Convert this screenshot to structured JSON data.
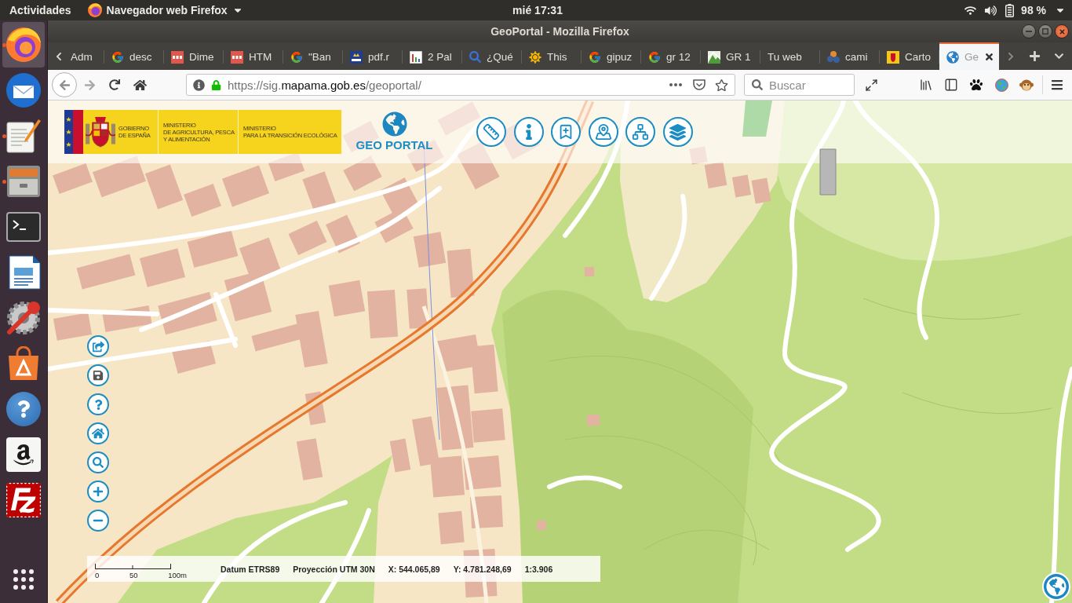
{
  "top_panel": {
    "activities": "Actividades",
    "app_menu": "Navegador web Firefox",
    "clock": "mié 17:31",
    "battery": "98 %"
  },
  "dock": {
    "items": [
      {
        "kind": "browser",
        "running": true,
        "selected": true
      },
      {
        "kind": "mail",
        "running": false,
        "selected": false
      },
      {
        "kind": "editor",
        "running": true,
        "selected": false
      },
      {
        "kind": "files",
        "running": true,
        "selected": false
      },
      {
        "kind": "terminal",
        "running": false,
        "selected": false
      },
      {
        "kind": "document",
        "running": false,
        "selected": false
      },
      {
        "kind": "settings",
        "running": false,
        "selected": false
      },
      {
        "kind": "store",
        "running": false,
        "selected": false
      },
      {
        "kind": "help",
        "running": false,
        "selected": false
      },
      {
        "kind": "shop",
        "running": false,
        "selected": false
      },
      {
        "kind": "ftp",
        "running": false,
        "selected": false
      }
    ]
  },
  "window": {
    "title": "GeoPortal - Mozilla Firefox"
  },
  "tabs": [
    {
      "label": "Adm",
      "kind": "plain",
      "selected": false
    },
    {
      "label": "desc",
      "kind": "google",
      "selected": false
    },
    {
      "label": "Dime",
      "kind": "tile",
      "selected": false
    },
    {
      "label": "HTM",
      "kind": "tile",
      "selected": false
    },
    {
      "label": "\"Ban",
      "kind": "google",
      "selected": false
    },
    {
      "label": "pdf.r",
      "kind": "crest",
      "selected": false
    },
    {
      "label": "2 Pal",
      "kind": "chart",
      "selected": false
    },
    {
      "label": "¿Qué",
      "kind": "search",
      "selected": false
    },
    {
      "label": "This",
      "kind": "sun",
      "selected": false
    },
    {
      "label": "gipuz",
      "kind": "google",
      "selected": false
    },
    {
      "label": "gr 12",
      "kind": "google",
      "selected": false
    },
    {
      "label": "GR 1",
      "kind": "mountain",
      "selected": false
    },
    {
      "label": "Tu web",
      "kind": "plain",
      "selected": false
    },
    {
      "label": "cami",
      "kind": "dots",
      "selected": false
    },
    {
      "label": "Carto",
      "kind": "flag",
      "selected": false
    },
    {
      "label": "Ge",
      "kind": "globe",
      "selected": true
    }
  ],
  "browser_toolbar": {
    "url": "https://sig.**mapama.gob.es**/geoportal/",
    "search_placeholder": "Buscar"
  },
  "geoportal": {
    "government": "GOBIERNO\nDE ESPAÑA",
    "ministries": [
      "MINISTERIO\nDE AGRICULTURA, PESCA\nY ALIMENTACIÓN",
      "MINISTERIO\nPARA LA TRANSICIÓN ECOLÓGICA"
    ],
    "brand": "GEO PORTAL",
    "toolbar": [
      {
        "kind": "measure"
      },
      {
        "kind": "info"
      },
      {
        "kind": "bookmark"
      },
      {
        "kind": "map"
      },
      {
        "kind": "tree"
      },
      {
        "kind": "layers"
      }
    ],
    "map_tools": [
      {
        "kind": "share"
      },
      {
        "kind": "save"
      },
      {
        "kind": "help"
      },
      {
        "kind": "home"
      },
      {
        "kind": "zoom"
      },
      {
        "kind": "zoom-in"
      },
      {
        "kind": "zoom-out"
      }
    ],
    "status_bar": {
      "scale_labels": [
        "0",
        "50",
        "100m"
      ],
      "datum": "Datum ETRS89",
      "projection": "Proyección UTM 30N",
      "x": "X: 544.065,89",
      "y": "Y: 4.781.248,69",
      "scale": "1:3.906"
    }
  }
}
